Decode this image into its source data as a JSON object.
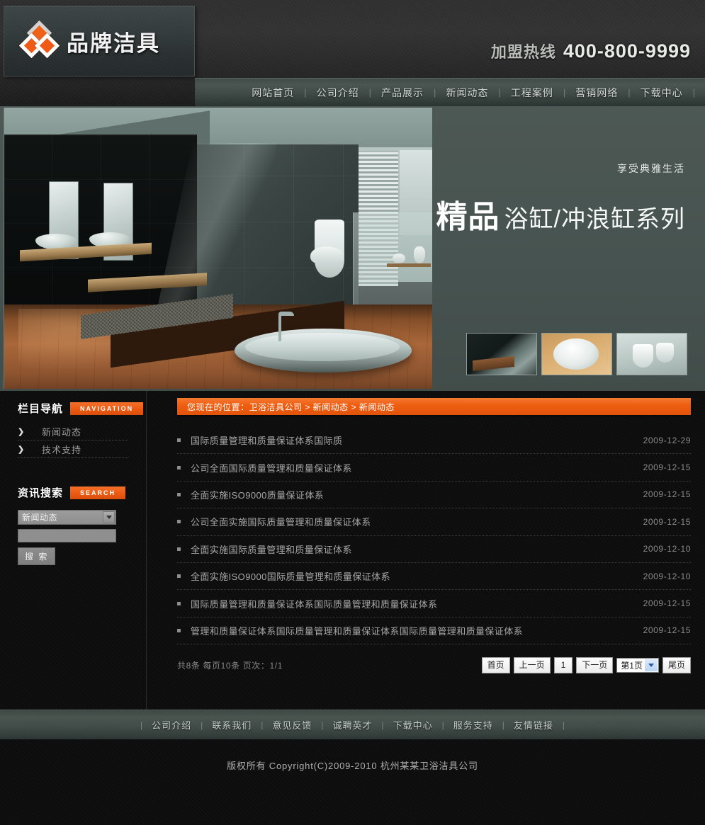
{
  "site": {
    "logo_text": "品牌洁具",
    "hotline_label": "加盟热线",
    "hotline_number": "400-800-9999",
    "accent_color": "#ee5d13",
    "nav_bar_color": "#475350"
  },
  "mainnav": {
    "separator": "|",
    "items": [
      {
        "label": "网站首页"
      },
      {
        "label": "公司介绍"
      },
      {
        "label": "产品展示"
      },
      {
        "label": "新闻动态"
      },
      {
        "label": "工程案例"
      },
      {
        "label": "营销网络"
      },
      {
        "label": "下载中心"
      }
    ]
  },
  "banner": {
    "subtitle": "享受典雅生活",
    "title_strong": "精品",
    "title_rest": "浴缸/冲浪缸系列",
    "thumbnails": [
      {
        "alt": "现代浴室全景"
      },
      {
        "alt": "台上洗面盆"
      },
      {
        "alt": "马桶与坐便器组合"
      }
    ]
  },
  "sidebar": {
    "nav": {
      "title_cn": "栏目导航",
      "title_en": "NAVIGATION",
      "arrow_icon": "❯",
      "items": [
        {
          "label": "新闻动态"
        },
        {
          "label": "技术支持"
        }
      ]
    },
    "search": {
      "title_cn": "资讯搜索",
      "title_en": "SEARCH",
      "select_value": "新闻动态",
      "select_options": [
        "新闻动态",
        "技术支持"
      ],
      "input_value": "",
      "input_placeholder": "",
      "button_label": "搜 索"
    }
  },
  "main": {
    "breadcrumb": "您现在的位置：卫浴洁具公司  >  新闻动态  >  新闻动态",
    "news": [
      {
        "title": "国际质量管理和质量保证体系国际质",
        "date": "2009-12-29"
      },
      {
        "title": "公司全面国际质量管理和质量保证体系",
        "date": "2009-12-15"
      },
      {
        "title": "全面实施ISO9000质量保证体系",
        "date": "2009-12-15"
      },
      {
        "title": "公司全面实施国际质量管理和质量保证体系",
        "date": "2009-12-15"
      },
      {
        "title": "全面实施国际质量管理和质量保证体系",
        "date": "2009-12-10"
      },
      {
        "title": "全面实施ISO9000国际质量管理和质量保证体系",
        "date": "2009-12-10"
      },
      {
        "title": "国际质量管理和质量保证体系国际质量管理和质量保证体系",
        "date": "2009-12-15"
      },
      {
        "title": "管理和质量保证体系国际质量管理和质量保证体系国际质量管理和质量保证体系",
        "date": "2009-12-15"
      }
    ],
    "pager": {
      "info": "共8条 每页10条 页次：1/1",
      "first": "首页",
      "prev": "上一页",
      "current": "1",
      "next": "下一页",
      "jump_value": "第1页",
      "jump_options": [
        "第1页"
      ],
      "last": "尾页"
    }
  },
  "footer": {
    "separator": "|",
    "links": [
      {
        "label": "公司介绍"
      },
      {
        "label": "联系我们"
      },
      {
        "label": "意见反馈"
      },
      {
        "label": "诚聘英才"
      },
      {
        "label": "下载中心"
      },
      {
        "label": "服务支持"
      },
      {
        "label": "友情链接"
      }
    ],
    "copyright": "版权所有  Copyright(C)2009-2010 杭州某某卫浴洁具公司"
  }
}
